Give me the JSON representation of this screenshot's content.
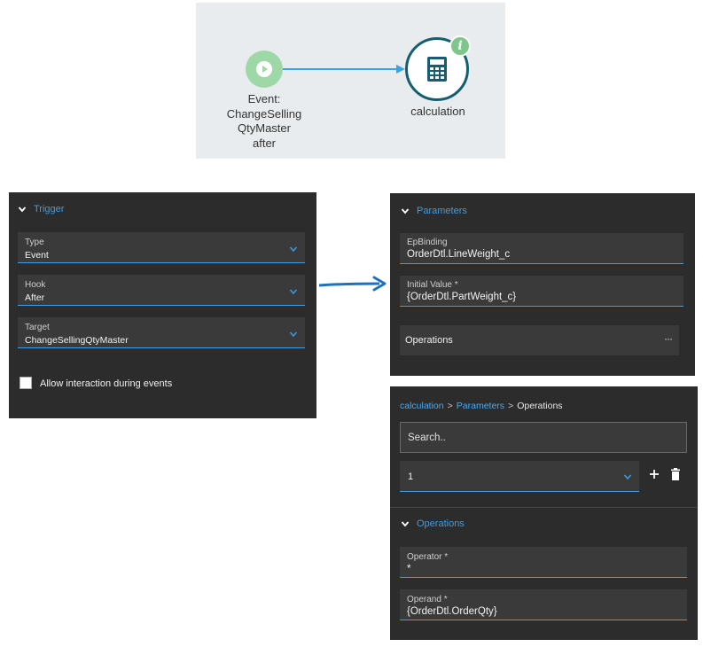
{
  "flow": {
    "start_label": "Event:\nChangeSelling\nQtyMaster\nafter",
    "start_label_lines": [
      "Event:",
      "ChangeSelling",
      "QtyMaster",
      "after"
    ],
    "calc_label": "calculation",
    "info_badge": "i",
    "colors": {
      "start": "#9ed8a6",
      "calc_border": "#155e70",
      "connector": "#3ba3e0",
      "badge": "#7fc68a"
    }
  },
  "trigger": {
    "title": "Trigger",
    "type": {
      "label": "Type",
      "value": "Event"
    },
    "hook": {
      "label": "Hook",
      "value": "After"
    },
    "target": {
      "label": "Target",
      "value": "ChangeSellingQtyMaster"
    },
    "allow_interaction": {
      "label": "Allow interaction during events",
      "checked": false
    }
  },
  "parameters": {
    "title": "Parameters",
    "ep_binding": {
      "label": "EpBinding",
      "value": "OrderDtl.LineWeight_c"
    },
    "initial_value": {
      "label": "Initial Value *",
      "value": "{OrderDtl.PartWeight_c}"
    },
    "operations": {
      "label": "Operations",
      "more": "···"
    }
  },
  "operations_panel": {
    "breadcrumb": {
      "item1": "calculation",
      "item2": "Parameters",
      "item3": "Operations",
      "sep": ">"
    },
    "search_placeholder": "Search..",
    "selected": "1",
    "section_title": "Operations",
    "operator": {
      "label": "Operator *",
      "value": "*"
    },
    "operand": {
      "label": "Operand *",
      "value": "{OrderDtl.OrderQty}"
    }
  },
  "accent": "#3c9ee6",
  "panel_bg": "#2c2c2c"
}
